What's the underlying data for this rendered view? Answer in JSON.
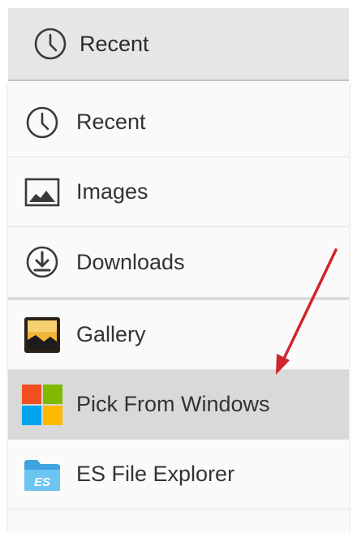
{
  "header": {
    "title": "Recent",
    "icon": "clock-icon"
  },
  "menu": {
    "items": [
      {
        "label": "Recent",
        "icon": "clock-icon"
      },
      {
        "label": "Images",
        "icon": "image-icon"
      },
      {
        "label": "Downloads",
        "icon": "download-icon"
      },
      {
        "label": "Gallery",
        "icon": "gallery-app-icon"
      },
      {
        "label": "Pick From Windows",
        "icon": "windows-app-icon",
        "highlighted": true
      },
      {
        "label": "ES File Explorer",
        "icon": "es-file-explorer-app-icon"
      }
    ]
  },
  "annotation": {
    "arrow_color": "#d0252a",
    "icon": "red-arrow"
  }
}
